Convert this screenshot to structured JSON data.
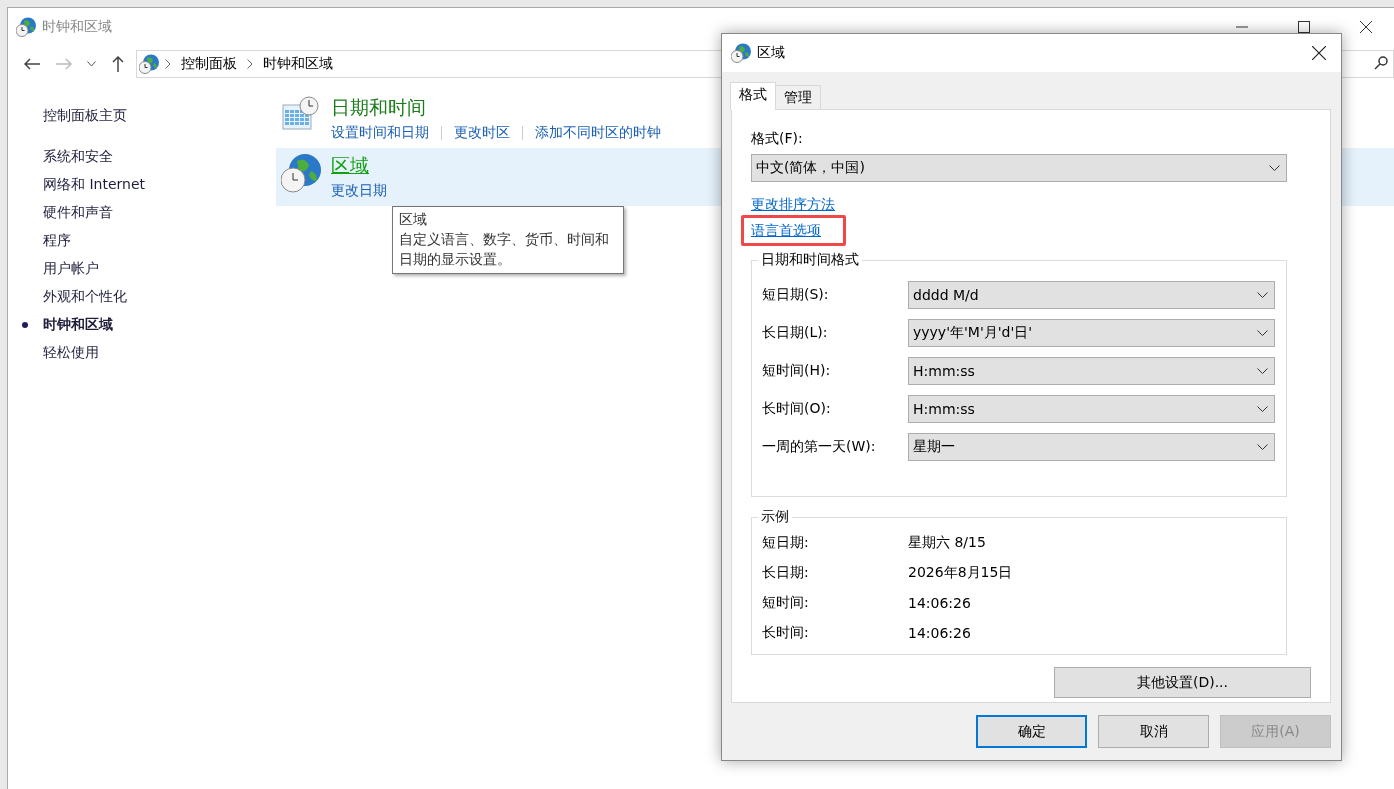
{
  "window": {
    "title": "时钟和区域"
  },
  "address_bar": {
    "breadcrumbs": [
      "控制面板",
      "时钟和区域"
    ]
  },
  "sidebar": {
    "home": "控制面板主页",
    "items": [
      {
        "label": "系统和安全",
        "selected": false
      },
      {
        "label": "网络和 Internet",
        "selected": false
      },
      {
        "label": "硬件和声音",
        "selected": false
      },
      {
        "label": "程序",
        "selected": false
      },
      {
        "label": "用户帐户",
        "selected": false
      },
      {
        "label": "外观和个性化",
        "selected": false
      },
      {
        "label": "时钟和区域",
        "selected": true
      },
      {
        "label": "轻松使用",
        "selected": false
      }
    ]
  },
  "categories": [
    {
      "kind": "calendar",
      "title": "日期和时间",
      "hovered": false,
      "links": [
        "设置时间和日期",
        "更改时区",
        "添加不同时区的时钟"
      ]
    },
    {
      "kind": "globe",
      "title": "区域",
      "hovered": true,
      "links": [
        "更改日期"
      ]
    }
  ],
  "tooltip": {
    "title": "区域",
    "text": "自定义语言、数字、货币、时间和日期的显示设置。"
  },
  "dialog": {
    "title": "区域",
    "tabs": [
      {
        "label": "格式",
        "selected": true
      },
      {
        "label": "管理",
        "selected": false
      }
    ],
    "format_label": "格式(F):",
    "format_value": "中文(简体，中国)",
    "links": [
      {
        "text": "更改排序方法",
        "highlighted": false
      },
      {
        "text": "语言首选项",
        "highlighted": true
      }
    ],
    "datetime_group": {
      "title": "日期和时间格式",
      "rows": [
        {
          "label": "短日期(S):",
          "value": "dddd M/d"
        },
        {
          "label": "长日期(L):",
          "value": "yyyy'年'M'月'd'日'"
        },
        {
          "label": "短时间(H):",
          "value": "H:mm:ss"
        },
        {
          "label": "长时间(O):",
          "value": "H:mm:ss"
        },
        {
          "label": "一周的第一天(W):",
          "value": "星期一"
        }
      ]
    },
    "example_group": {
      "title": "示例",
      "rows": [
        {
          "label": "短日期:",
          "value": "星期六 8/15"
        },
        {
          "label": "长日期:",
          "value": "2026年8月15日"
        },
        {
          "label": "短时间:",
          "value": "14:06:26"
        },
        {
          "label": "长时间:",
          "value": "14:06:26"
        }
      ]
    },
    "more_button": "其他设置(D)...",
    "buttons": [
      {
        "label": "确定",
        "kind": "default"
      },
      {
        "label": "取消",
        "kind": "normal"
      },
      {
        "label": "应用(A)",
        "kind": "disabled"
      }
    ]
  }
}
